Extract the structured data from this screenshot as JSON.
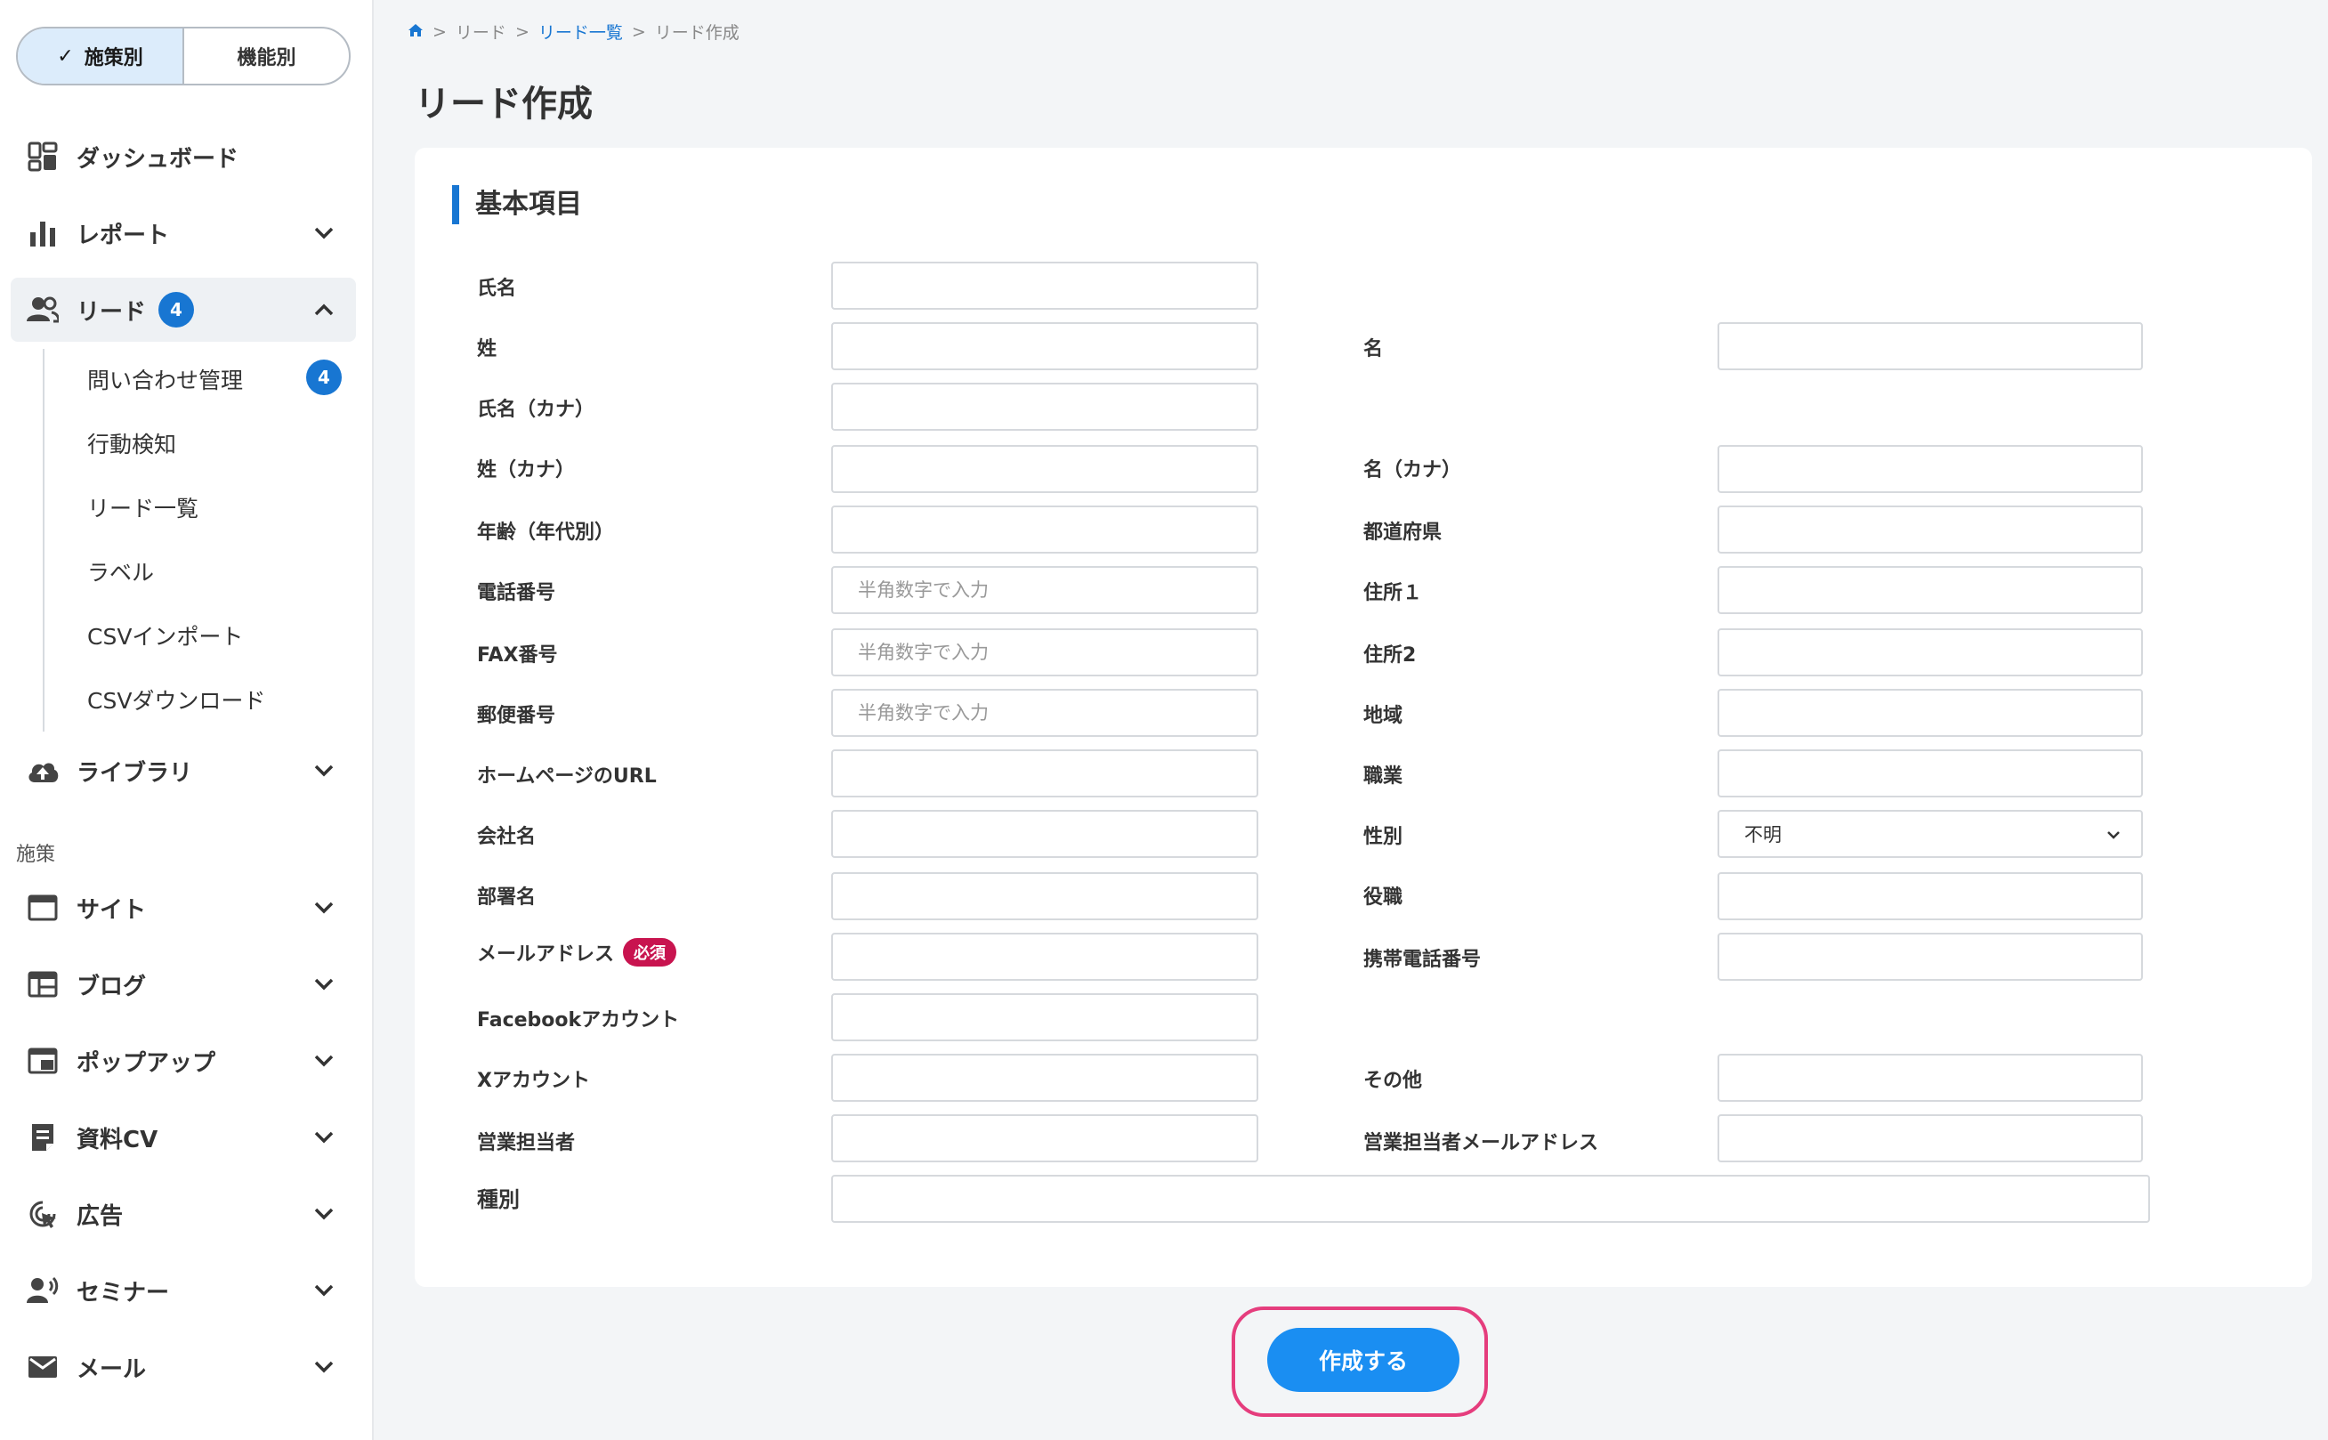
{
  "sidebar": {
    "toggle": {
      "active_label": "施策別",
      "inactive_label": "機能別"
    },
    "top_items": [
      {
        "label": "ダッシュボード",
        "icon": "dashboard-icon"
      },
      {
        "label": "レポート",
        "icon": "bar-chart-icon"
      },
      {
        "label": "リード",
        "icon": "people-icon",
        "badge": "4"
      },
      {
        "label": "ライブラリ",
        "icon": "cloud-upload-icon"
      }
    ],
    "lead_sub_items": [
      {
        "label": "問い合わせ管理",
        "badge": "4"
      },
      {
        "label": "行動検知"
      },
      {
        "label": "リード一覧"
      },
      {
        "label": "ラベル"
      },
      {
        "label": "CSVインポート"
      },
      {
        "label": "CSVダウンロード"
      }
    ],
    "section_label": "施策",
    "measure_items": [
      {
        "label": "サイト",
        "icon": "browser-window-icon"
      },
      {
        "label": "ブログ",
        "icon": "table-layout-icon"
      },
      {
        "label": "ポップアップ",
        "icon": "popup-icon"
      },
      {
        "label": "資料CV",
        "icon": "document-icon"
      },
      {
        "label": "広告",
        "icon": "target-cursor-icon"
      },
      {
        "label": "セミナー",
        "icon": "speaker-person-icon"
      },
      {
        "label": "メール",
        "icon": "envelope-icon"
      }
    ]
  },
  "breadcrumb": [
    "リード",
    "リード一覧",
    "リード作成"
  ],
  "page_title": "リード作成",
  "section_heading": "基本項目",
  "fields": {
    "full_name": {
      "label": "氏名",
      "value": ""
    },
    "last_name": {
      "label": "姓",
      "value": ""
    },
    "first_name": {
      "label": "名",
      "value": ""
    },
    "full_name_kana": {
      "label": "氏名（カナ）",
      "value": ""
    },
    "last_name_kana": {
      "label": "姓（カナ）",
      "value": ""
    },
    "first_name_kana": {
      "label": "名（カナ）",
      "value": ""
    },
    "age": {
      "label": "年齢（年代別）",
      "value": ""
    },
    "prefecture": {
      "label": "都道府県",
      "value": ""
    },
    "phone": {
      "label": "電話番号",
      "placeholder": "半角数字で入力"
    },
    "address1": {
      "label": "住所１",
      "value": ""
    },
    "fax": {
      "label": "FAX番号",
      "placeholder": "半角数字で入力"
    },
    "address2": {
      "label": "住所2",
      "value": ""
    },
    "postal_code": {
      "label": "郵便番号",
      "placeholder": "半角数字で入力"
    },
    "region": {
      "label": "地域",
      "value": ""
    },
    "homepage_url": {
      "label": "ホームページのURL",
      "value": ""
    },
    "occupation": {
      "label": "職業",
      "value": ""
    },
    "company": {
      "label": "会社名",
      "value": ""
    },
    "gender": {
      "label": "性別",
      "selected": "不明"
    },
    "department": {
      "label": "部署名",
      "value": ""
    },
    "position": {
      "label": "役職",
      "value": ""
    },
    "email": {
      "label": "メールアドレス",
      "required_badge": "必須",
      "value": ""
    },
    "mobile": {
      "label": "携帯電話番号",
      "value": ""
    },
    "facebook": {
      "label": "Facebookアカウント",
      "value": ""
    },
    "x_account": {
      "label": "Xアカウント",
      "value": ""
    },
    "other": {
      "label": "その他",
      "value": ""
    },
    "sales_rep": {
      "label": "営業担当者",
      "value": ""
    },
    "sales_rep_email": {
      "label": "営業担当者メールアドレス",
      "value": ""
    },
    "category": {
      "label": "種別",
      "value": ""
    }
  },
  "submit_label": "作成する",
  "colors": {
    "accent": "#1876d2",
    "button": "#1a8ef2",
    "required": "#c8144f",
    "highlight_ring": "#e53d7d"
  }
}
